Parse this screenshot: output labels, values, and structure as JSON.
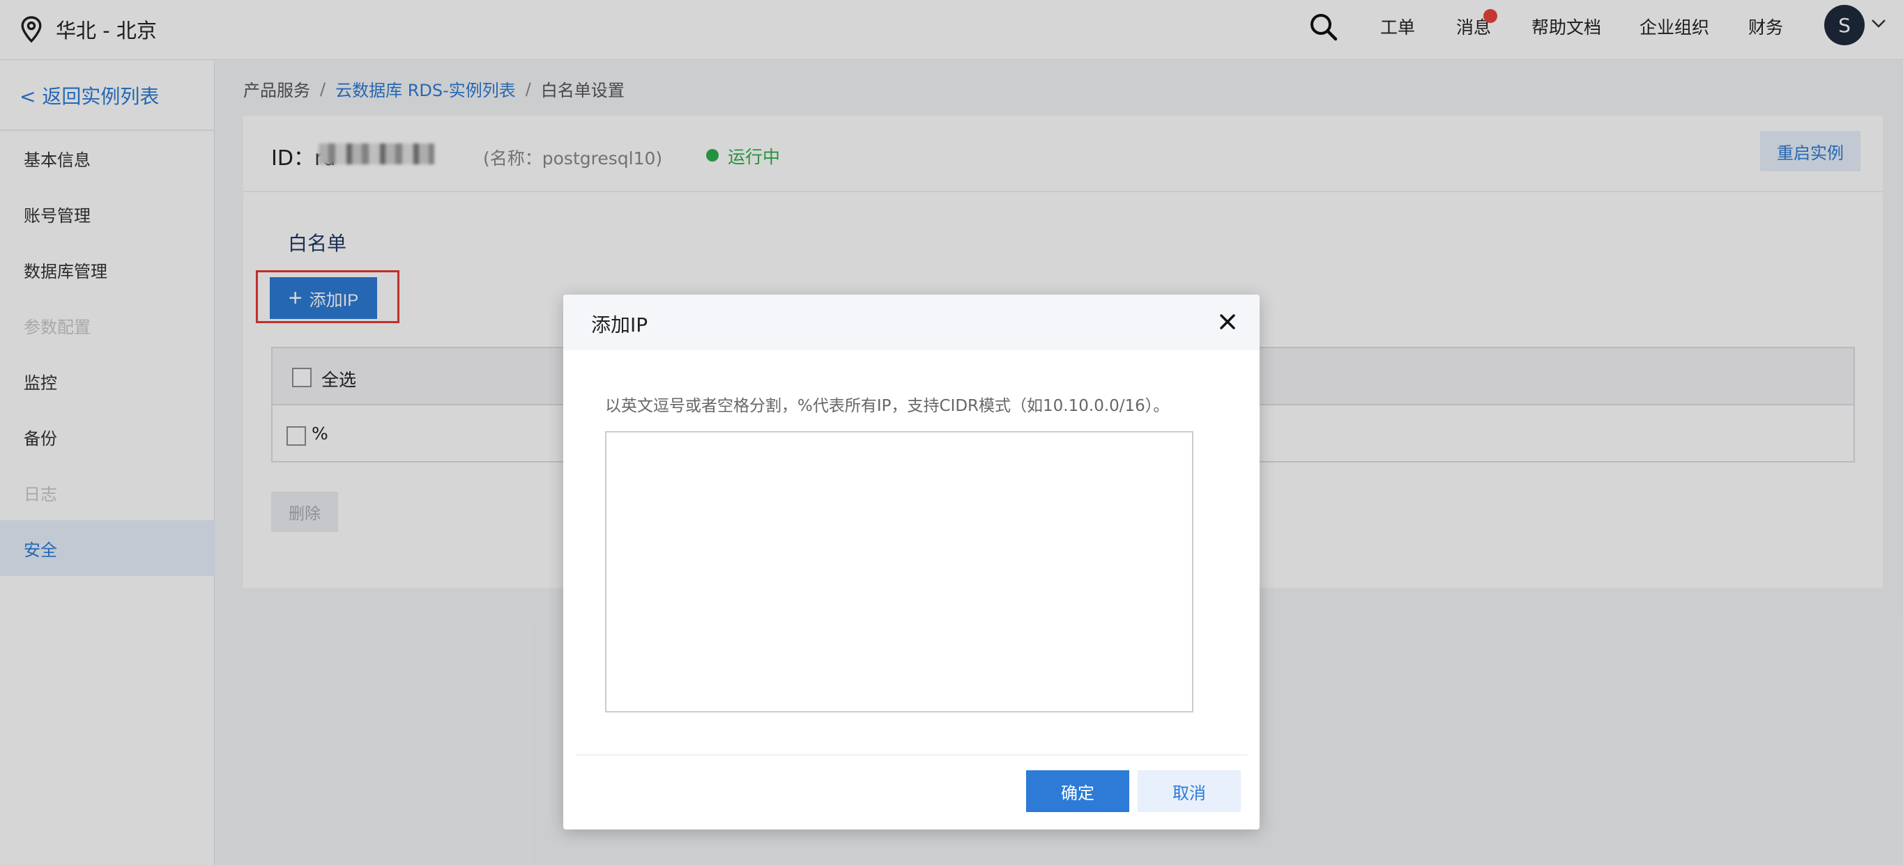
{
  "header": {
    "region": "华北 - 北京",
    "nav": {
      "tickets": "工单",
      "messages": "消息",
      "help_docs": "帮助文档",
      "org": "企业组织",
      "finance": "财务"
    },
    "avatar_letter": "S"
  },
  "sidebar": {
    "back": "< 返回实例列表",
    "items": [
      {
        "label": "基本信息",
        "state": "normal"
      },
      {
        "label": "账号管理",
        "state": "normal"
      },
      {
        "label": "数据库管理",
        "state": "normal"
      },
      {
        "label": "参数配置",
        "state": "disabled"
      },
      {
        "label": "监控",
        "state": "normal"
      },
      {
        "label": "备份",
        "state": "normal"
      },
      {
        "label": "日志",
        "state": "disabled"
      },
      {
        "label": "安全",
        "state": "active"
      }
    ]
  },
  "breadcrumb": {
    "item1": "产品服务",
    "item2": "云数据库 RDS-实例列表",
    "item3": "白名单设置",
    "separator": "/"
  },
  "instance": {
    "id_label": "ID：rd",
    "name": "(名称：postgresql10)",
    "status": "运行中",
    "restart_label": "重启实例"
  },
  "whitelist": {
    "title": "白名单",
    "add_ip_label": "添加IP",
    "select_all_label": "全选",
    "rows": [
      {
        "value": "%"
      }
    ],
    "delete_label": "删除"
  },
  "modal": {
    "title": "添加IP",
    "hint": "以英文逗号或者空格分割，%代表所有IP，支持CIDR模式（如10.10.0.0/16）。",
    "textarea_value": "",
    "confirm_label": "确定",
    "cancel_label": "取消"
  },
  "colors": {
    "accent": "#2d7bd6",
    "status_green": "#2fae4a",
    "highlight_red": "#e53935",
    "badge_red": "#e8443b"
  }
}
